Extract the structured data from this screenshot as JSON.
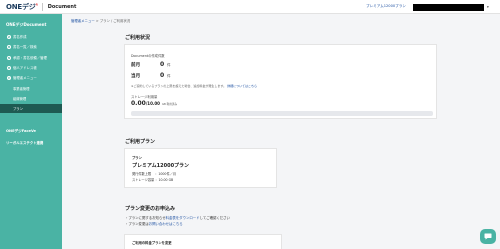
{
  "header": {
    "logo": "ONEデジ",
    "logo_mark": "R",
    "title": "Document",
    "plan_link": "プレミアム12000プラン",
    "caret": "▾"
  },
  "sidebar": {
    "title": "ONEデジDocument",
    "items": [
      {
        "label": "書名作成",
        "icon": "pen-icon"
      },
      {
        "label": "書名一覧／検索",
        "icon": "search-icon"
      },
      {
        "label": "承認・書名依頼／管理",
        "icon": "approve-icon"
      },
      {
        "label": "個人アドレス帳",
        "icon": "address-book-icon"
      },
      {
        "label": "管理者メニュー",
        "icon": "gear-icon"
      }
    ],
    "subitems": [
      {
        "label": "事業者管理"
      },
      {
        "label": "組織管理"
      },
      {
        "label": "プラン"
      }
    ],
    "other_sections": [
      "ONEデジFaceVe",
      "リーガルエステクト連携"
    ]
  },
  "breadcrumb": {
    "root": "管理者メニュー",
    "sep": ">",
    "current": "プラン / ご利用状況"
  },
  "usage": {
    "section_title": "ご利用状況",
    "doc_label": "Documentの作成件数",
    "prev_label": "前月",
    "prev_value": "0",
    "curr_label": "当月",
    "curr_value": "0",
    "unit": "件",
    "note": "※ご契約しているプランの上限を超えた場合、追加料金が発生します。",
    "note_link": "詳細についてはこちら",
    "storage_label": "ストレージ利用量",
    "storage_used": "0.00",
    "storage_sep": "/",
    "storage_total": "10.00",
    "storage_unit": "GB 利用済み",
    "storage_fraction": 0.0
  },
  "plan": {
    "section_title": "ご利用プラン",
    "label": "プラン",
    "name": "プレミアム12000プラン",
    "rows": [
      {
        "key": "発行件数上限",
        "value": "：1000件／月"
      },
      {
        "key": "ストレージ容量",
        "value": "：10.00 GB"
      }
    ]
  },
  "change": {
    "section_title": "プラン変更のお申込み",
    "bullet1_pre": "・プランに関するお知らせ",
    "bullet1_link": "料金表をダウンロード",
    "bullet1_post": "してご確認ください",
    "bullet2_pre": "・プラン変更は",
    "bullet2_link": "お問い合わせはこちら",
    "card_label": "ご利用の料金プランを変更"
  },
  "colors": {
    "accent": "#4ab3a4",
    "sidebar_active": "#1e5a52",
    "link": "#1a4ea0"
  }
}
